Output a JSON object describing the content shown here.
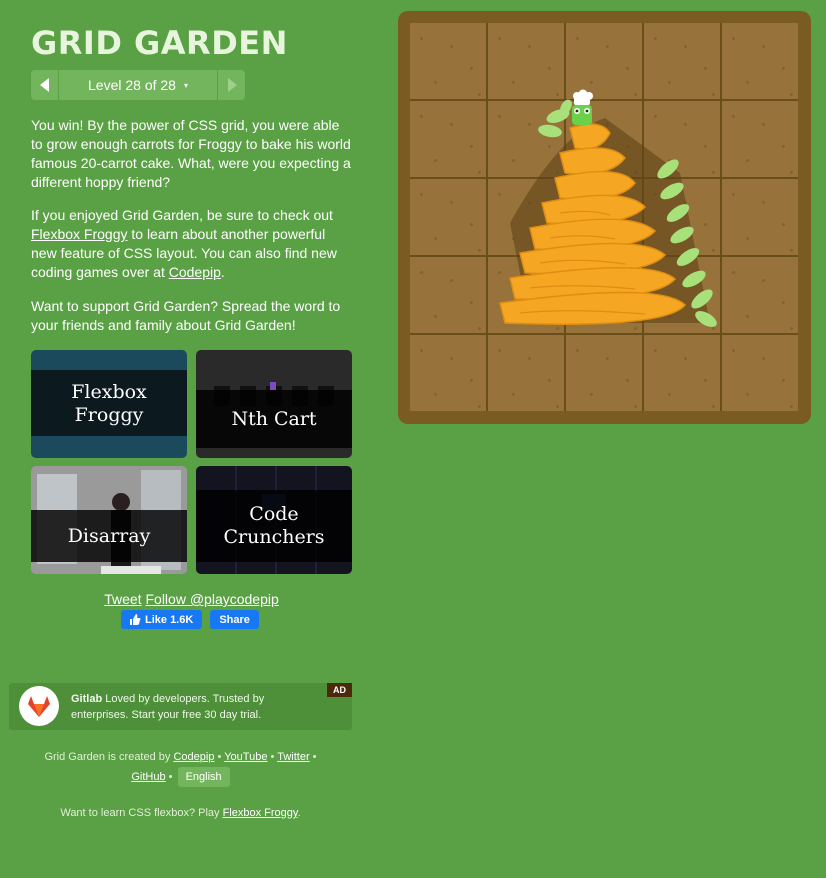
{
  "app": {
    "title": "GRID GARDEN",
    "level_label": "Level 28 of 28",
    "level_caret": "▾"
  },
  "content": {
    "p1": "You win! By the power of CSS grid, you were able to grow enough carrots for Froggy to bake his world famous 20-carrot cake. What, were you expecting a different hoppy friend?",
    "p2_before": "If you enjoyed Grid Garden, be sure to check out ",
    "p2_link1": "Flexbox Froggy",
    "p2_middle": " to learn about another powerful new feature of CSS layout. You can also find new coding games over at ",
    "p2_link2": "Codepip",
    "p2_after": ".",
    "p3": "Want to support Grid Garden? Spread the word to your friends and family about Grid Garden!"
  },
  "promos": [
    {
      "label": "Flexbox\nFroggy"
    },
    {
      "label": "Nth Cart"
    },
    {
      "label": "Disarray"
    },
    {
      "label": "Code\nCrunchers"
    }
  ],
  "social": {
    "tweet": "Tweet",
    "follow": "Follow @playcodepip",
    "like": "Like 1.6K",
    "share": "Share"
  },
  "ad": {
    "brand": "Gitlab",
    "text": " Loved by developers. Trusted by enterprises. Start your free 30 day trial.",
    "badge": "AD"
  },
  "footer": {
    "created_by": "Grid Garden is created by ",
    "codepip": "Codepip",
    "youtube": "YouTube",
    "twitter": "Twitter",
    "github": "GitHub",
    "bullet": " • ",
    "language": "English",
    "learn_prefix": "Want to learn CSS flexbox? Play ",
    "learn_link": "Flexbox Froggy",
    "learn_suffix": "."
  },
  "colors": {
    "background": "#5aa045",
    "board_frame": "#7a5c22",
    "soil": "#98723b",
    "carrot": "#f5a623",
    "leaf": "#a8e07a"
  }
}
